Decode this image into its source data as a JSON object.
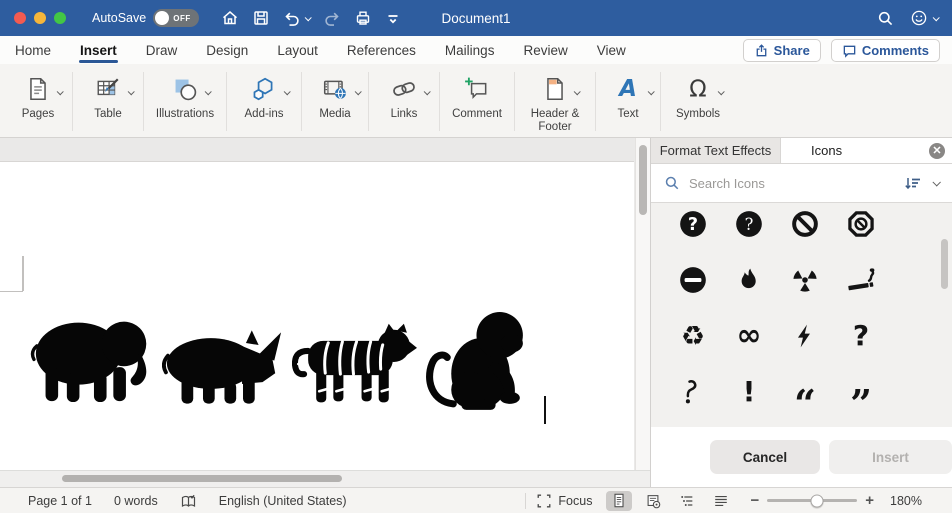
{
  "window": {
    "title": "Document1"
  },
  "titlebar": {
    "autosave_label": "AutoSave",
    "autosave_state": "OFF"
  },
  "ribbon_tabs": [
    {
      "label": "Home"
    },
    {
      "label": "Insert",
      "active": true
    },
    {
      "label": "Draw"
    },
    {
      "label": "Design"
    },
    {
      "label": "Layout"
    },
    {
      "label": "References"
    },
    {
      "label": "Mailings"
    },
    {
      "label": "Review"
    },
    {
      "label": "View"
    }
  ],
  "top_actions": {
    "share_label": "Share",
    "comments_label": "Comments"
  },
  "ribbon_groups": [
    {
      "label": "Pages"
    },
    {
      "label": "Table"
    },
    {
      "label": "Illustrations"
    },
    {
      "label": "Add-ins"
    },
    {
      "label": "Media"
    },
    {
      "label": "Links"
    },
    {
      "label": "Comment"
    },
    {
      "label": "Header & Footer"
    },
    {
      "label": "Text"
    },
    {
      "label": "Symbols"
    }
  ],
  "document": {
    "animal_icons": [
      "elephant",
      "rhinoceros",
      "tiger",
      "monkey"
    ]
  },
  "icons_panel": {
    "tab_format": "Format Text Effects",
    "tab_icons": "Icons",
    "search_placeholder": "Search Icons",
    "grid_icons": [
      "question-mark-circle",
      "question-mark-circle-alt",
      "prohibition",
      "prohibition-octagon",
      "no-entry",
      "flame",
      "radiation",
      "smoking",
      "recycle",
      "infinity",
      "lightning-bolt",
      "question-mark",
      "question-mark-open",
      "exclamation-mark",
      "quote-open",
      "quote-close"
    ],
    "glyphs": {
      "question": "?",
      "exclamation": "!",
      "infinity": "∞",
      "recycle": "♻",
      "quote_open": "“",
      "quote_close": "”"
    },
    "cancel_label": "Cancel",
    "insert_label": "Insert"
  },
  "statusbar": {
    "page": "Page 1 of 1",
    "words": "0 words",
    "language": "English (United States)",
    "focus_label": "Focus",
    "zoom_level": "180%"
  },
  "colors": {
    "titlebar": "#2e5d9f",
    "accent_blue": "#2e75b6",
    "tab_underline": "#2b5796",
    "icon_black": "#1b1b1b",
    "green": "#21a366",
    "orange": "#f4b183"
  }
}
